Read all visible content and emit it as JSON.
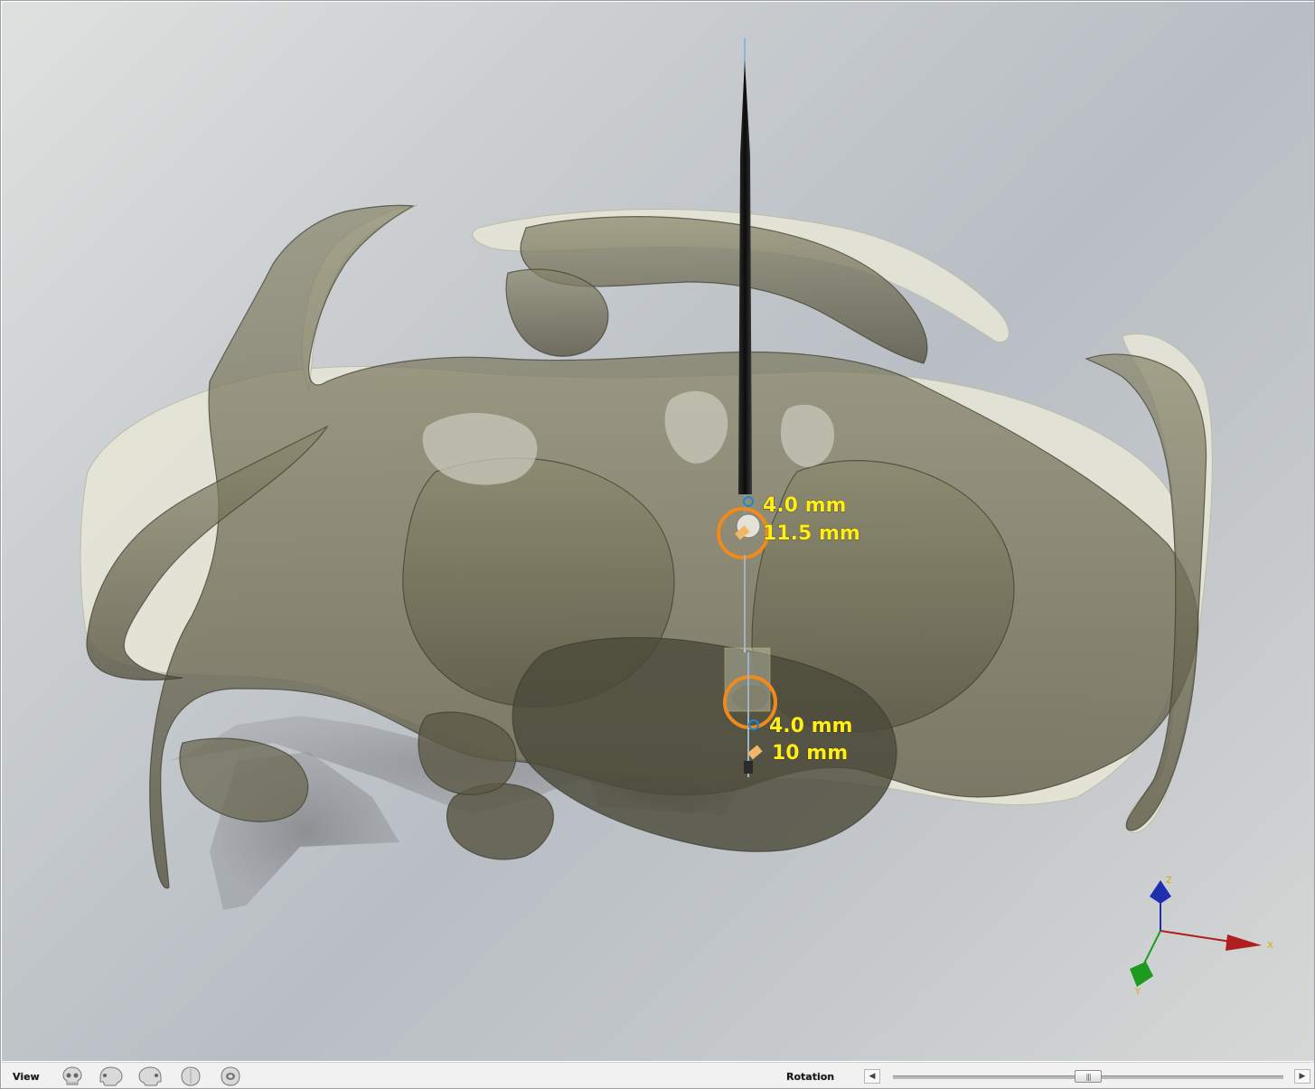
{
  "viewer": {
    "implants": [
      {
        "diameter": "4.0 mm",
        "length": "11.5 mm"
      },
      {
        "diameter": "4.0 mm",
        "length": "10 mm"
      }
    ],
    "axes": {
      "x": "X",
      "y": "Y",
      "z": "Z"
    },
    "colors": {
      "bone": "#6f6b55",
      "bone_light": "#e8e6d8",
      "implant_ring": "#f08a1c",
      "label": "#ffee1a",
      "axis_x": "#b01f1f",
      "axis_y": "#1e9a1e",
      "axis_z": "#1f2fb0"
    }
  },
  "toolbar": {
    "view_label": "View",
    "view_buttons": [
      "skull-front-icon",
      "skull-side-left-icon",
      "skull-side-right-icon",
      "skull-top-icon",
      "skull-bottom-icon"
    ],
    "rotation_label": "Rotation",
    "scroll_left": "◀",
    "scroll_right": "▶",
    "thumb_grip": "|||",
    "rotation_value": 0.5
  }
}
